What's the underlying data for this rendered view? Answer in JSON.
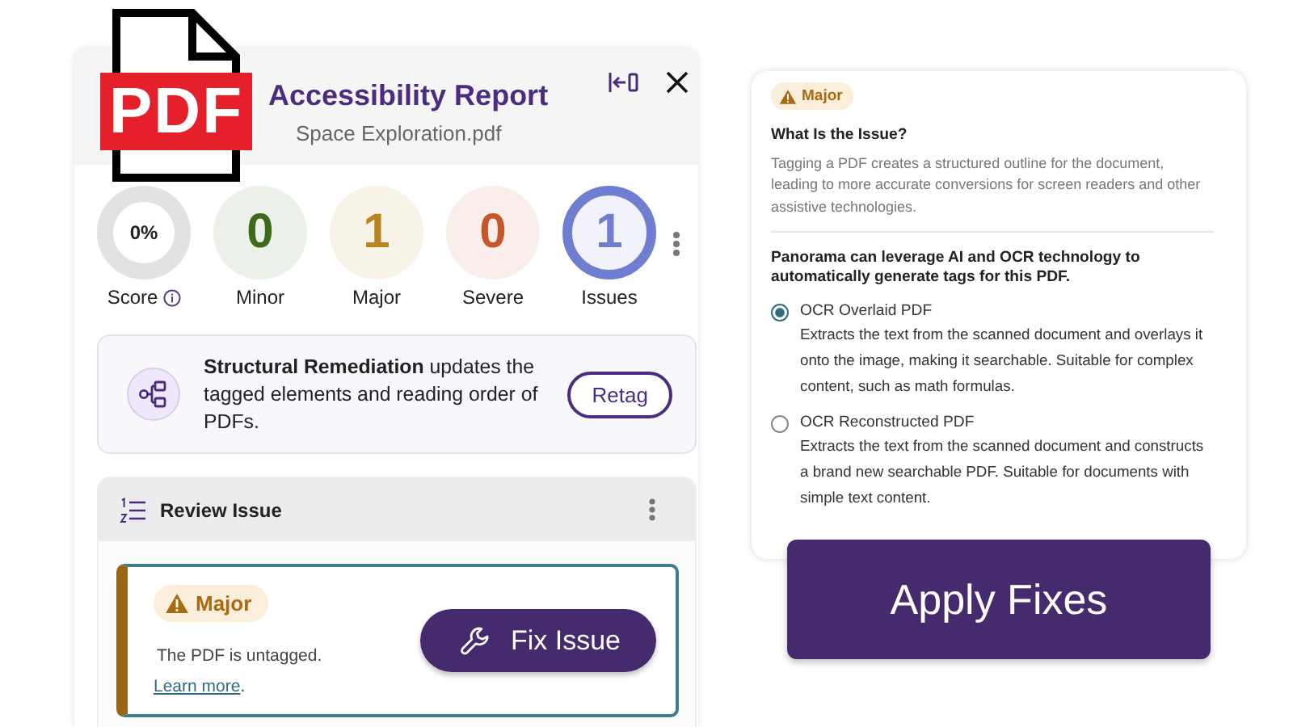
{
  "logo": {
    "text": "PDF"
  },
  "report": {
    "title": "Accessibility Report",
    "file": "Space Exploration.pdf",
    "stats": [
      {
        "kind": "score",
        "value": "0%",
        "label": "Score",
        "level": 0
      },
      {
        "kind": "count",
        "value": "0",
        "label": "Minor",
        "color": "#3b6a1c"
      },
      {
        "kind": "count",
        "value": "1",
        "label": "Major",
        "color": "#b8841f"
      },
      {
        "kind": "count",
        "value": "0",
        "label": "Severe",
        "color": "#c8562b"
      },
      {
        "kind": "total",
        "value": "1",
        "label": "Issues",
        "color": "#6f7ed0"
      }
    ],
    "remediation": {
      "text": "**Structural Remediation** updates the tagged elements and reading order of PDFs.",
      "button": "Retag"
    },
    "review": {
      "title": "Review Issue",
      "issue": {
        "severity": "Major",
        "message": "The PDF is untagged.",
        "link": "Learn more",
        "link_after": ".",
        "button": "Fix Issue"
      }
    }
  },
  "detail": {
    "severity": "Major",
    "heading": "What Is the Issue?",
    "description": "Tagging a PDF creates a structured outline for the document, leading to more accurate conversions for screen readers and other assistive technologies.",
    "prompt": "Panorama can leverage AI and OCR technology to automatically generate tags for this PDF.",
    "options": [
      {
        "label": "OCR Overlaid PDF",
        "description": "Extracts the text from the scanned document and overlays it onto the image, making it searchable. Suitable for complex content, such as math formulas.",
        "selected": true
      },
      {
        "label": "OCR Reconstructed PDF",
        "description": "Extracts the text from the scanned document and constructs a brand new searchable PDF. Suitable for documents with simple text content.",
        "selected": false
      }
    ]
  },
  "apply_button": "Apply Fixes"
}
